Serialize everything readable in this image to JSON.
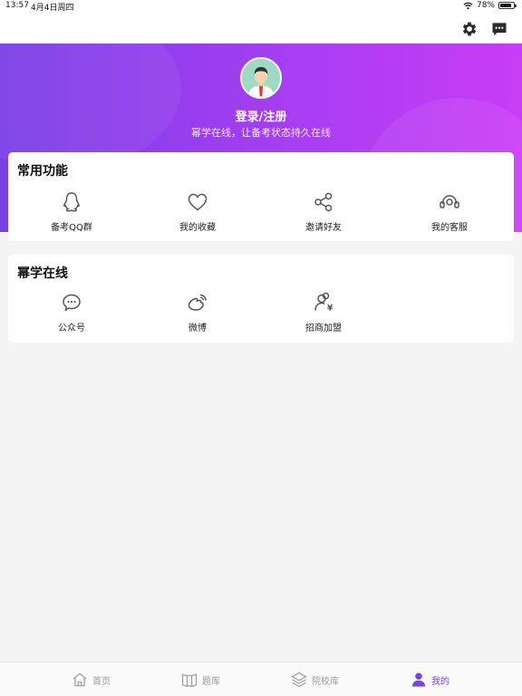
{
  "status_bar": {
    "time": "13:57",
    "date": "4月4日周四",
    "battery": "78%",
    "battery_level": 0.78
  },
  "header": {
    "login_title": "登录/注册",
    "subtitle": "幂学在线，让备考状态持久在线"
  },
  "common_functions": {
    "title": "常用功能",
    "items": [
      {
        "label": "备考QQ群",
        "icon": "qq-icon"
      },
      {
        "label": "我的收藏",
        "icon": "heart-icon"
      },
      {
        "label": "邀请好友",
        "icon": "share-icon"
      },
      {
        "label": "我的客服",
        "icon": "headset-icon"
      }
    ]
  },
  "brand_section": {
    "title": "幂学在线",
    "items": [
      {
        "label": "公众号",
        "icon": "wechat-icon"
      },
      {
        "label": "微博",
        "icon": "weibo-icon"
      },
      {
        "label": "招商加盟",
        "icon": "franchise-icon"
      }
    ]
  },
  "tab_bar": {
    "tabs": [
      {
        "label": "首页",
        "icon": "home-icon"
      },
      {
        "label": "题库",
        "icon": "book-icon"
      },
      {
        "label": "院校库",
        "icon": "layers-icon"
      },
      {
        "label": "我的",
        "icon": "user-icon",
        "active": true
      }
    ]
  },
  "colors": {
    "accent": "#7b3fe4",
    "header_gradient_start": "#7a3fe6",
    "header_gradient_end": "#c93cf6"
  }
}
